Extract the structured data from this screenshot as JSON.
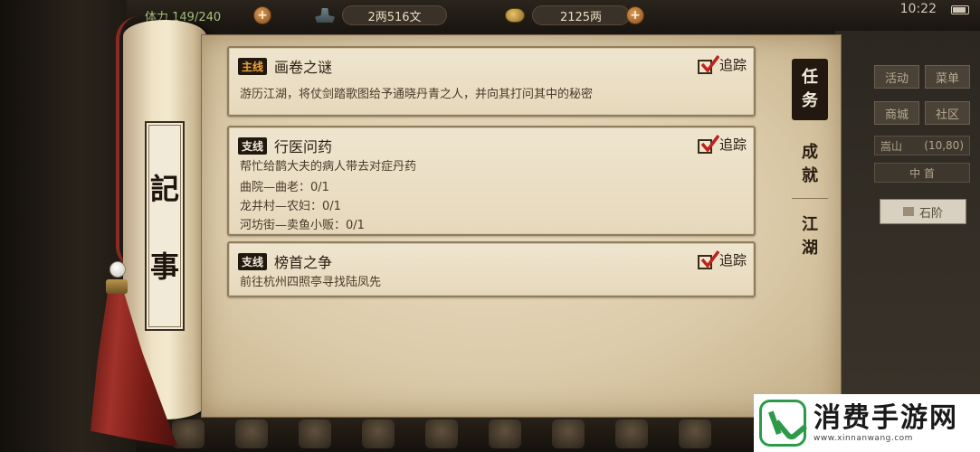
{
  "hud": {
    "stamina": "体力 149/240",
    "silver": "2两516文",
    "gold": "2125两",
    "time": "10:22"
  },
  "side_panel": {
    "buttons": [
      "活动",
      "菜单",
      "商城",
      "社区"
    ],
    "location": {
      "name": "嵩山",
      "coords": "(10,80)"
    },
    "sub_row": "中 首",
    "step_label": "石阶"
  },
  "journal": {
    "title_chars": [
      "記",
      "事"
    ]
  },
  "tabs": [
    {
      "label_chars": [
        "任",
        "务"
      ],
      "active": true
    },
    {
      "label_chars": [
        "成",
        "就"
      ],
      "active": false
    },
    {
      "label_chars": [
        "江",
        "湖"
      ],
      "active": false
    }
  ],
  "quests": [
    {
      "type": "主线",
      "title": "画卷之谜",
      "description": "游历江湖，将仗剑踏歌图给予通晓丹青之人，并向其打问其中的秘密",
      "objectives": [],
      "track_label": "追踪",
      "tracked": true
    },
    {
      "type": "支线",
      "title": "行医问药",
      "description": "帮忙给鹊大夫的病人带去对症丹药",
      "objectives": [
        "曲院—曲老：0/1",
        "龙井村—农妇：0/1",
        "河坊街—卖鱼小贩：0/1"
      ],
      "track_label": "追踪",
      "tracked": true
    },
    {
      "type": "支线",
      "title": "榜首之争",
      "description": "前往杭州四照亭寻找陆凤先",
      "objectives": [],
      "track_label": "追踪",
      "tracked": true
    }
  ],
  "watermark": {
    "title": "消费手游网",
    "url": "www.xinnanwang.com"
  }
}
